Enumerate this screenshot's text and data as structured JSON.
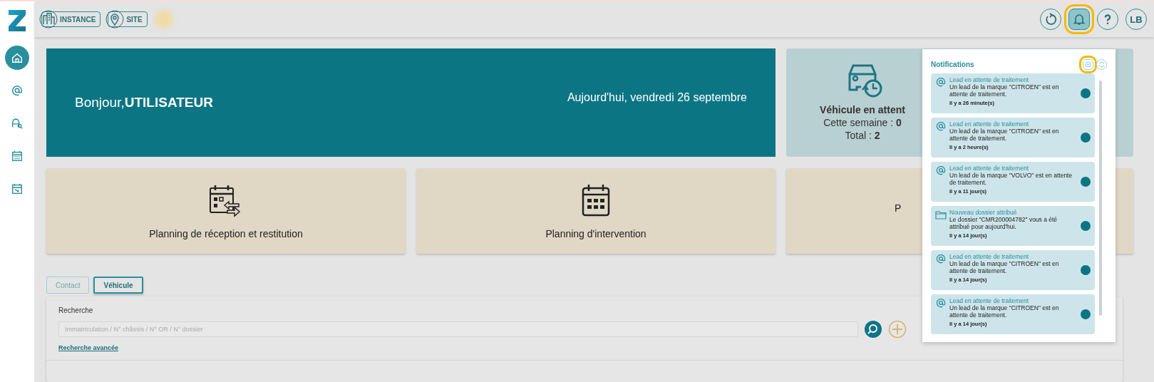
{
  "sidebar": {
    "items": [
      {
        "selected": true
      },
      {
        "selected": false
      },
      {
        "selected": false
      },
      {
        "selected": false
      },
      {
        "selected": false
      }
    ]
  },
  "topbar": {
    "chips": [
      {
        "label": "INSTANCE"
      },
      {
        "label": "SITE"
      }
    ],
    "actions": [
      {
        "highlighted": false
      },
      {
        "highlighted": true
      },
      {
        "highlighted": false
      },
      {
        "label": "LB",
        "highlighted": false
      }
    ]
  },
  "banner": {
    "greeting": "Bonjour,",
    "user": "UTILISATEUR",
    "date": "Aujourd'hui, vendredi 26 septembre"
  },
  "vehicle_card": {
    "title": "Véhicule en attent",
    "week_label": "Cette semaine : ",
    "week_value": "0",
    "total_label": "Total : ",
    "total_value": "2"
  },
  "tiles": [
    {
      "label": "Planning de réception et restitution"
    },
    {
      "label": "Planning d'intervention"
    },
    {
      "label": "P"
    }
  ],
  "tabs": [
    {
      "label": "Contact",
      "selected": false
    },
    {
      "label": "Véhicule",
      "selected": true
    }
  ],
  "search": {
    "label": "Recherche",
    "placeholder": "Immatriculation / N° châssis / N° OR / N° dossier",
    "advanced_link": "Recherche avancée"
  },
  "notifications": {
    "title": "Notifications",
    "mark_all_highlighted": true,
    "items": [
      {
        "kind": "lead",
        "title": "Lead en attente de traitement",
        "body": "Un lead de la marque \"CITROEN\" est en attente de traitement.",
        "time": "Il y a 26 minute(s)",
        "unread": true
      },
      {
        "kind": "lead",
        "title": "Lead en attente de traitement",
        "body": "Un lead de la marque \"CITROEN\" est en attente de traitement.",
        "time": "Il y a 2 heure(s)",
        "unread": true
      },
      {
        "kind": "lead",
        "title": "Lead en attente de traitement",
        "body": "Un lead de la marque \"VOLVO\" est en attente de traitement.",
        "time": "Il y a 11 jour(s)",
        "unread": true
      },
      {
        "kind": "folder",
        "title": "Nouveau dossier attribué",
        "body": "Le dossier \"CMR200004782\" vous a été attribué pour aujourd'hui.",
        "time": "Il y a 14 jour(s)",
        "unread": true
      },
      {
        "kind": "lead",
        "title": "Lead en attente de traitement",
        "body": "Un lead de la marque \"CITROEN\" est en attente de traitement.",
        "time": "Il y a 14 jour(s)",
        "unread": true
      },
      {
        "kind": "lead",
        "title": "Lead en attente de traitement",
        "body": "Un lead de la marque \"CITROEN\" est en attente de traitement.",
        "time": "Il y a 14 jour(s)",
        "unread": true
      }
    ]
  }
}
